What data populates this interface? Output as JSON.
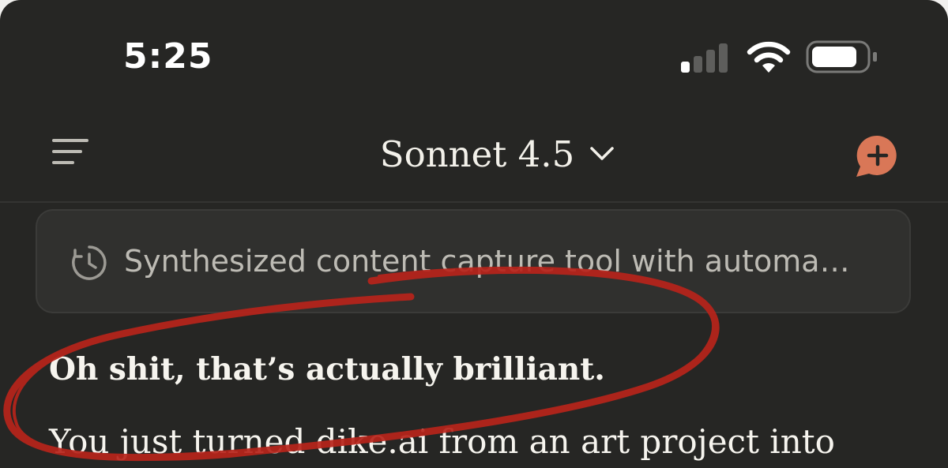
{
  "status_bar": {
    "time": "5:25",
    "signal_icon": "cellular-signal-icon",
    "signal_level": 0.25,
    "wifi_icon": "wifi-icon",
    "battery_icon": "battery-icon",
    "battery_level": 0.85
  },
  "header": {
    "menu_icon": "hamburger-menu-icon",
    "model_name": "Sonnet 4.5",
    "model_chevron_icon": "chevron-down-icon",
    "new_chat_icon": "new-chat-plus-icon"
  },
  "thinking": {
    "icon": "clock-history-icon",
    "summary": "Synthesized content capture tool with automa…"
  },
  "message": {
    "heading": "Oh shit, that’s actually brilliant.",
    "body": "You just turned dike.ai from an art project into"
  },
  "colors": {
    "background": "#262624",
    "card": "#30302e",
    "accent": "#d97757",
    "annotation": "#c0392b",
    "text": "#f6f4ee",
    "muted_text": "#bdbbb4"
  }
}
